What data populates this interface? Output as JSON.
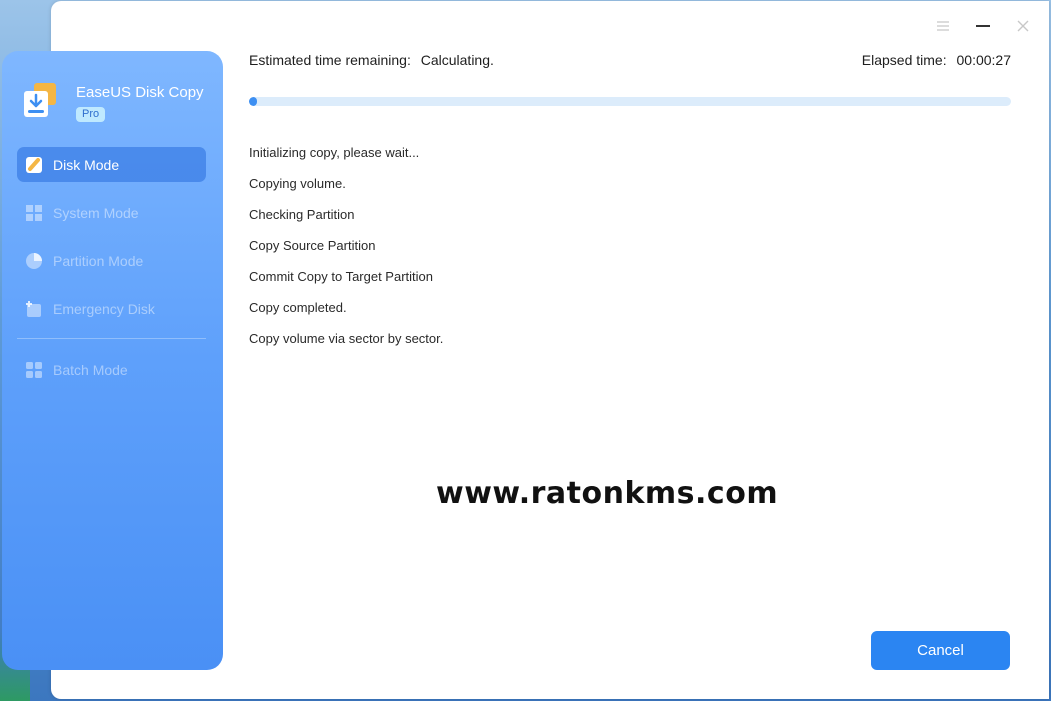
{
  "app": {
    "name": "EaseUS Disk Copy",
    "badge": "Pro"
  },
  "sidebar": {
    "items": [
      {
        "label": "Disk Mode",
        "icon": "disk-mode-icon",
        "active": true
      },
      {
        "label": "System Mode",
        "icon": "windows-icon",
        "active": false
      },
      {
        "label": "Partition Mode",
        "icon": "pie-chart-icon",
        "active": false
      },
      {
        "label": "Emergency Disk",
        "icon": "emergency-disk-icon",
        "active": false
      },
      {
        "label": "Batch Mode",
        "icon": "grid-icon",
        "active": false
      }
    ]
  },
  "titlebar": {
    "menu_icon": "menu-icon",
    "minimize_icon": "minimize-icon",
    "close_icon": "close-icon"
  },
  "status": {
    "remaining_label": "Estimated time remaining:",
    "remaining_value": "Calculating.",
    "elapsed_label": "Elapsed time:",
    "elapsed_value": "00:00:27",
    "progress_fraction": 0.01
  },
  "log": [
    "Initializing copy, please wait...",
    "Copying volume.",
    "Checking Partition",
    "Copy Source Partition",
    "Commit Copy to Target Partition",
    "Copy completed.",
    "Copy volume via sector by sector."
  ],
  "watermark": "www.ratonkms.com",
  "actions": {
    "cancel_label": "Cancel"
  },
  "colors": {
    "accent": "#2b85f2",
    "sidebar_top": "#7fb7ff",
    "sidebar_bottom": "#4a90f5",
    "progress_track": "#dcecfb"
  }
}
